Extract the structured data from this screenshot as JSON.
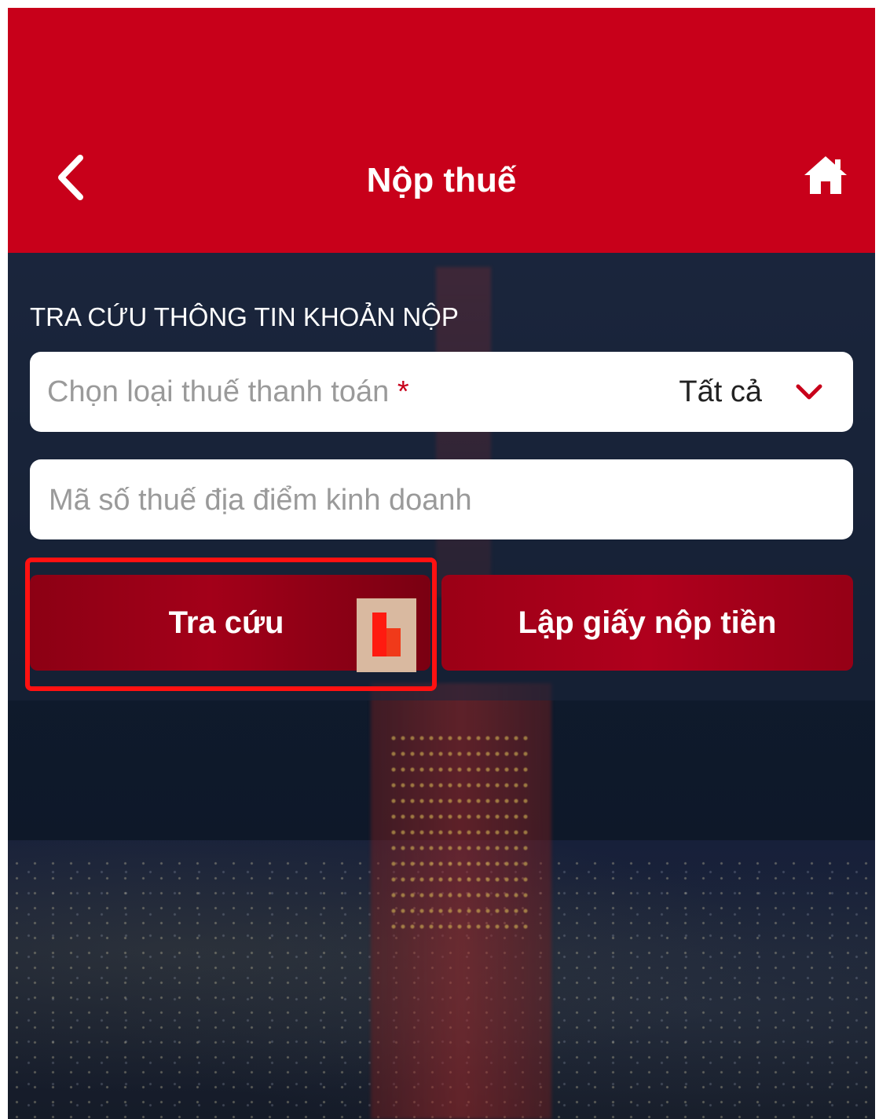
{
  "header": {
    "title": "Nộp thuế",
    "back_icon": "chevron-left-icon",
    "home_icon": "home-icon",
    "color": "#c8001a"
  },
  "section": {
    "title": "TRA CỨU THÔNG TIN KHOẢN NỘP"
  },
  "tax_type_select": {
    "label": "Chọn loại thuế thanh toán",
    "required_mark": "*",
    "value": "Tất cả",
    "icon": "chevron-down-icon"
  },
  "tax_code_input": {
    "placeholder": "Mã số thuế địa điểm kinh doanh",
    "value": ""
  },
  "buttons": {
    "search_label": "Tra cứu",
    "create_label": "Lập giấy nộp tiền"
  },
  "colors": {
    "accent": "#c8001a",
    "highlight": "#ff1111"
  }
}
